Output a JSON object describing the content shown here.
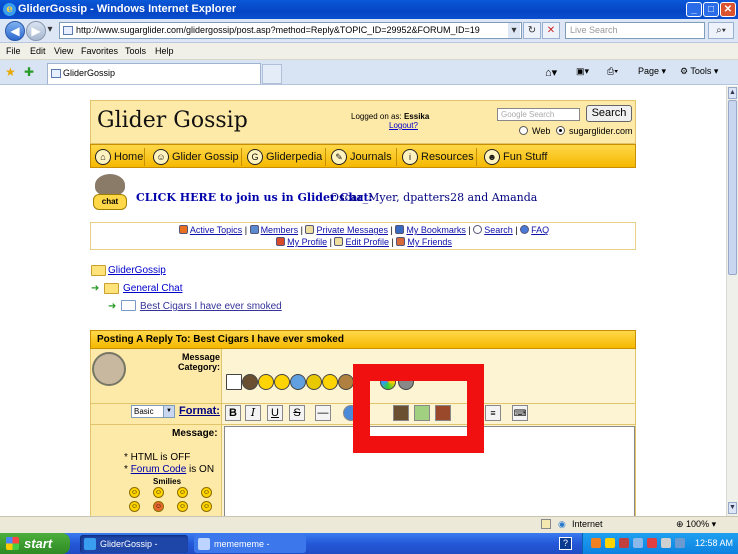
{
  "window": {
    "title": "GliderGossip - Windows Internet Explorer",
    "min": "_",
    "max": "□",
    "close": "✕"
  },
  "browser": {
    "back": "◀",
    "forward": "▶",
    "address": "http://www.sugarglider.com/glidergossip/post.asp?method=Reply&TOPIC_ID=29952&FORUM_ID=19",
    "search_placeholder": "Live Search",
    "menu": [
      "File",
      "Edit",
      "View",
      "Favorites",
      "Tools",
      "Help"
    ],
    "tab_title": "GliderGossip",
    "page_menu": "Page",
    "tools_menu": "Tools"
  },
  "site": {
    "logo": "Glider Gossip",
    "logged_label": "Logged on as:",
    "user": "Essika",
    "logout": "Logout?",
    "google_placeholder": "Google Search",
    "search_button": "Search",
    "radio_web": "Web",
    "radio_site": "sugarglider.com",
    "nav": [
      {
        "label": "Home",
        "icon": "home-icon"
      },
      {
        "label": "Glider Gossip",
        "icon": "people-icon"
      },
      {
        "label": "Gliderpedia",
        "icon": "book-icon"
      },
      {
        "label": "Journals",
        "icon": "pencil-icon"
      },
      {
        "label": "Resources",
        "icon": "info-icon"
      },
      {
        "label": "Fun Stuff",
        "icon": "mask-icon"
      }
    ],
    "chat_icon_label": "chat",
    "chat_link": "CLICK HERE to join us in Glider Chat:",
    "chat_names": "Oscar_Myer, dpatters28 and Amanda",
    "links_row1": [
      "Active Topics",
      "Members",
      "Private Messages",
      "My Bookmarks",
      "Search",
      "FAQ"
    ],
    "links_row2": [
      "My Profile",
      "Edit Profile",
      "My Friends"
    ],
    "sep": "|",
    "breadcrumbs": [
      "GliderGossip",
      "General Chat",
      "Best Cigars I have ever smoked"
    ]
  },
  "form": {
    "header": "Posting A Reply To: Best Cigars I have ever smoked",
    "category_label": "Message Category:",
    "format_select": "Basic",
    "format_label": "Format:",
    "toolbar": [
      "B",
      "I",
      "U",
      "S",
      "—"
    ],
    "message_label": "Message:",
    "html_status_prefix": "* HTML is",
    "html_status": "OFF",
    "forum_code_prefix": "*",
    "forum_code_link": "Forum Code",
    "forum_code_status": "is ON",
    "smilies_label": "Smilies"
  },
  "statusbar": {
    "zone": "Internet",
    "zoom": "100%"
  },
  "taskbar": {
    "start": "start",
    "tasks": [
      "GliderGossip - Windo...",
      "memememe - Notepad"
    ],
    "clock": "12:58 AM"
  }
}
